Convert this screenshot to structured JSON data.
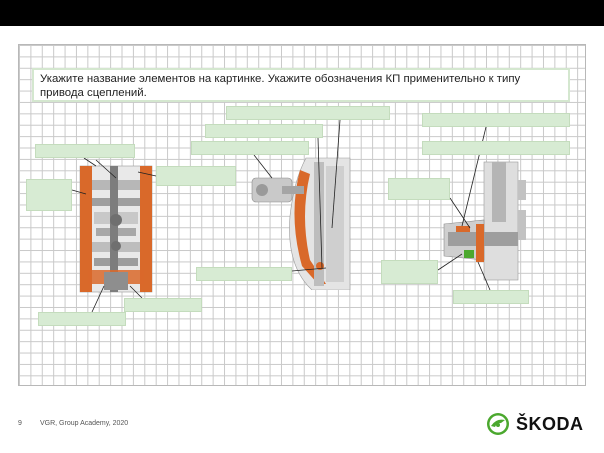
{
  "slide": {
    "task_text": "Укажите название элементов на картинке. Укажите обозначения КП применительно к типу привода сцеплений.",
    "page_number": "9",
    "footer_text": "VGR, Group Academy, 2020",
    "brand": "ŠKODA"
  },
  "colors": {
    "label_fill": "#d7ebd3",
    "grid_line": "#c9c9c9",
    "top_bar": "#000000",
    "brand_green": "#4ba82e"
  },
  "label_boxes": {
    "left_figure": [
      "empty",
      "empty",
      "empty",
      "empty",
      "empty"
    ],
    "center_figure": [
      "empty",
      "empty",
      "empty",
      "empty"
    ],
    "right_figure": [
      "empty",
      "empty",
      "empty",
      "empty",
      "empty"
    ]
  },
  "icons": [
    "skoda-logo-icon",
    "gearbox-cutaway-image",
    "clutch-housing-image",
    "clutch-slave-cylinder-image"
  ]
}
